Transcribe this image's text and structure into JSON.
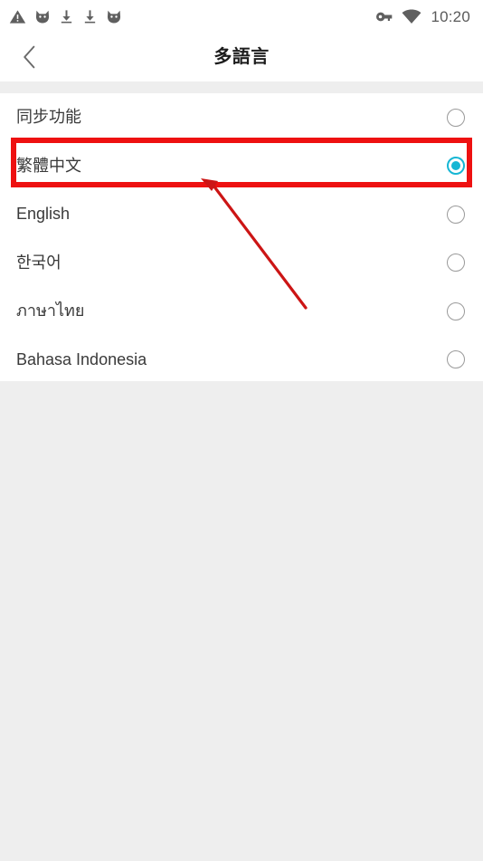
{
  "status_bar": {
    "left_icons": [
      {
        "name": "warning-triangle-icon"
      },
      {
        "name": "cat-face-icon"
      },
      {
        "name": "download-icon"
      },
      {
        "name": "download-icon"
      },
      {
        "name": "cat-face-icon"
      }
    ],
    "right_icons": [
      {
        "name": "vpn-key-icon"
      },
      {
        "name": "wifi-icon"
      }
    ],
    "clock": "10:20"
  },
  "header": {
    "back_icon": "chevron-left-icon",
    "title": "多語言"
  },
  "language_list": {
    "rows": [
      {
        "label": "同步功能",
        "selected": false
      },
      {
        "label": "繁體中文",
        "selected": true
      },
      {
        "label": "English",
        "selected": false
      },
      {
        "label": "한국어",
        "selected": false
      },
      {
        "label": "ภาษาไทย",
        "selected": false
      },
      {
        "label": "Bahasa Indonesia",
        "selected": false
      }
    ]
  },
  "annotation": {
    "highlight_color": "#ee1111",
    "arrow_color": "#cc1515",
    "target_row_label": "繁體中文"
  },
  "colors": {
    "accent": "#16b6d4",
    "page_background": "#eeeeee",
    "surface": "#ffffff",
    "text_primary": "#3a3a3a",
    "title_text": "#1d1d1d",
    "icon_gray": "#5f5f5f",
    "radio_border": "#9a9a9a"
  }
}
